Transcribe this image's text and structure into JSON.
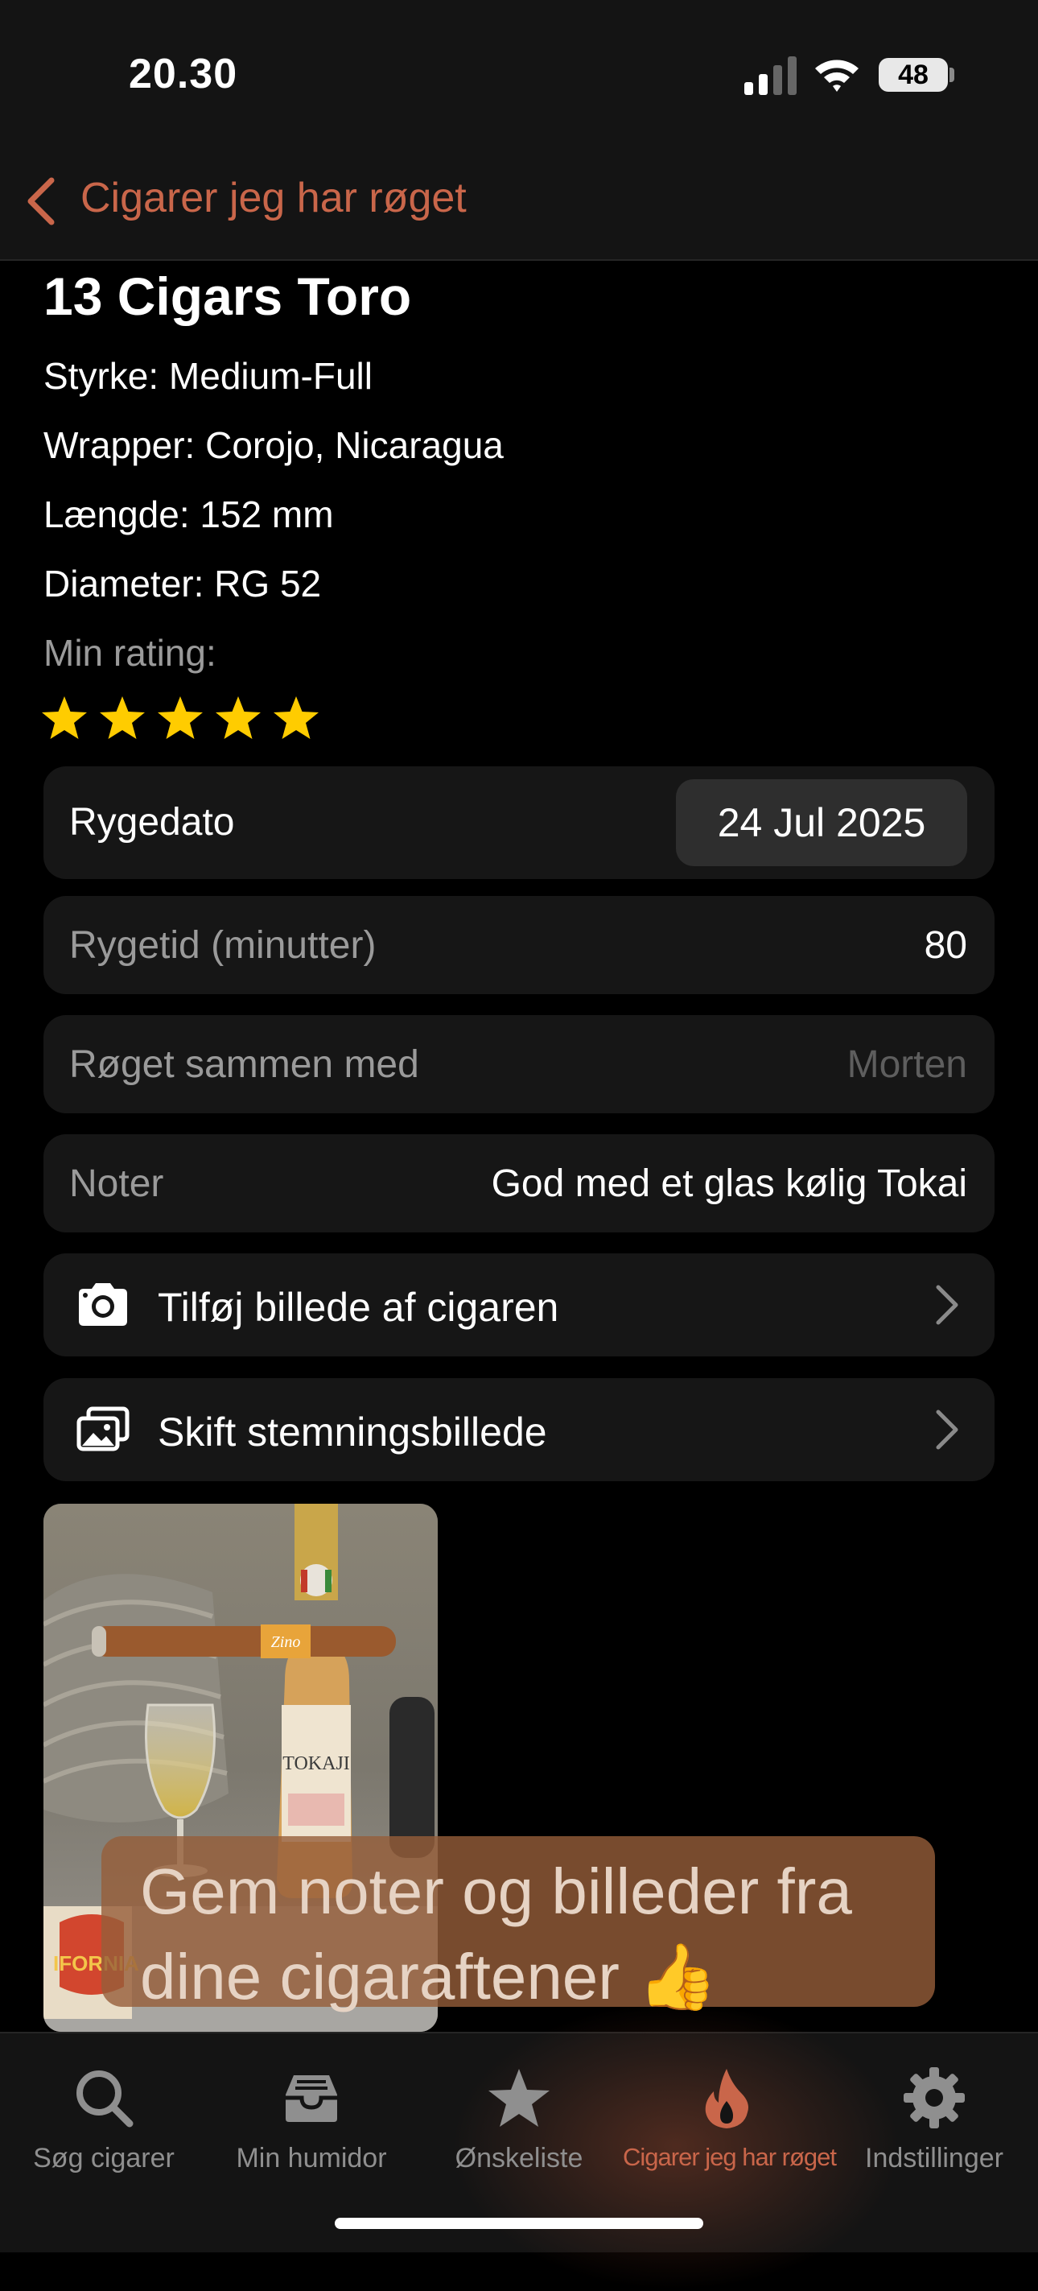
{
  "status_bar": {
    "time": "20.30",
    "battery": "48"
  },
  "nav": {
    "back_label": "Cigarer jeg har røget"
  },
  "cigar": {
    "name": "13 Cigars Toro",
    "strength": "Styrke: Medium-Full",
    "wrapper": "Wrapper: Corojo, Nicaragua",
    "length": "Længde: 152 mm",
    "diameter": "Diameter: RG 52",
    "rating_label": "Min rating:",
    "rating": 5,
    "rating_max": 5
  },
  "fields": {
    "smoke_date_label": "Rygedato",
    "smoke_date_value": "24 Jul 2025",
    "smoke_time_label": "Rygetid (minutter)",
    "smoke_time_value": "80",
    "smoked_with_label": "Røget sammen med",
    "smoked_with_placeholder": "Morten",
    "notes_label": "Noter",
    "notes_value": "God med et glas kølig Tokai"
  },
  "actions": {
    "add_photo": "Tilføj billede af cigaren",
    "change_mood_photo": "Skift stemningsbillede"
  },
  "photo": {
    "band_text": "Zino",
    "bottle_text": "TOKAJI",
    "mug_text": "IFORNIA"
  },
  "promo": {
    "line1": "Gem noter og billeder fra",
    "line2": "dine cigaraftener 👍"
  },
  "tabs": [
    {
      "label": "Søg cigarer",
      "icon": "search-icon"
    },
    {
      "label": "Min humidor",
      "icon": "tray-icon"
    },
    {
      "label": "Ønskeliste",
      "icon": "star-icon"
    },
    {
      "label": "Cigarer jeg har røget",
      "icon": "flame-icon",
      "active": true
    },
    {
      "label": "Indstillinger",
      "icon": "gear-icon"
    }
  ],
  "colors": {
    "accent": "#c9664a",
    "star": "#ffcc00",
    "card": "#161616"
  }
}
